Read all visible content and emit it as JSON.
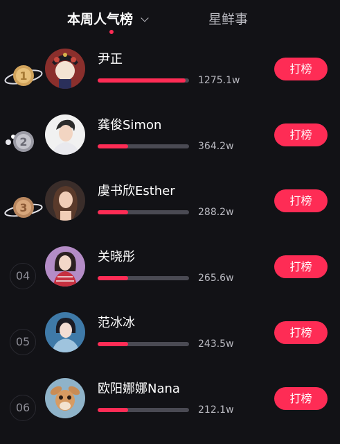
{
  "tabs": {
    "active_label": "本周人气榜",
    "inactive_label": "星鲜事"
  },
  "action_label": "打榜",
  "accent_color": "#fe2c55",
  "rows": [
    {
      "rank": "1",
      "name": "尹正",
      "score": "1275.1w",
      "progress": 0.96,
      "medal": "gold",
      "avatar_icon": "opera-mask-portrait-icon"
    },
    {
      "rank": "2",
      "name": "龚俊Simon",
      "score": "364.2w",
      "progress": 0.33,
      "medal": "silver",
      "avatar_icon": "man-portrait-icon"
    },
    {
      "rank": "3",
      "name": "虞书欣Esther",
      "score": "288.2w",
      "progress": 0.33,
      "medal": "bronze",
      "avatar_icon": "woman-portrait-icon"
    },
    {
      "rank": "04",
      "name": "关晓彤",
      "score": "265.6w",
      "progress": 0.33,
      "medal": "",
      "avatar_icon": "woman-red-dress-portrait-icon"
    },
    {
      "rank": "05",
      "name": "范冰冰",
      "score": "243.5w",
      "progress": 0.33,
      "medal": "",
      "avatar_icon": "woman-blue-portrait-icon"
    },
    {
      "rank": "06",
      "name": "欧阳娜娜Nana",
      "score": "212.1w",
      "progress": 0.33,
      "medal": "",
      "avatar_icon": "deer-cartoon-icon"
    }
  ]
}
